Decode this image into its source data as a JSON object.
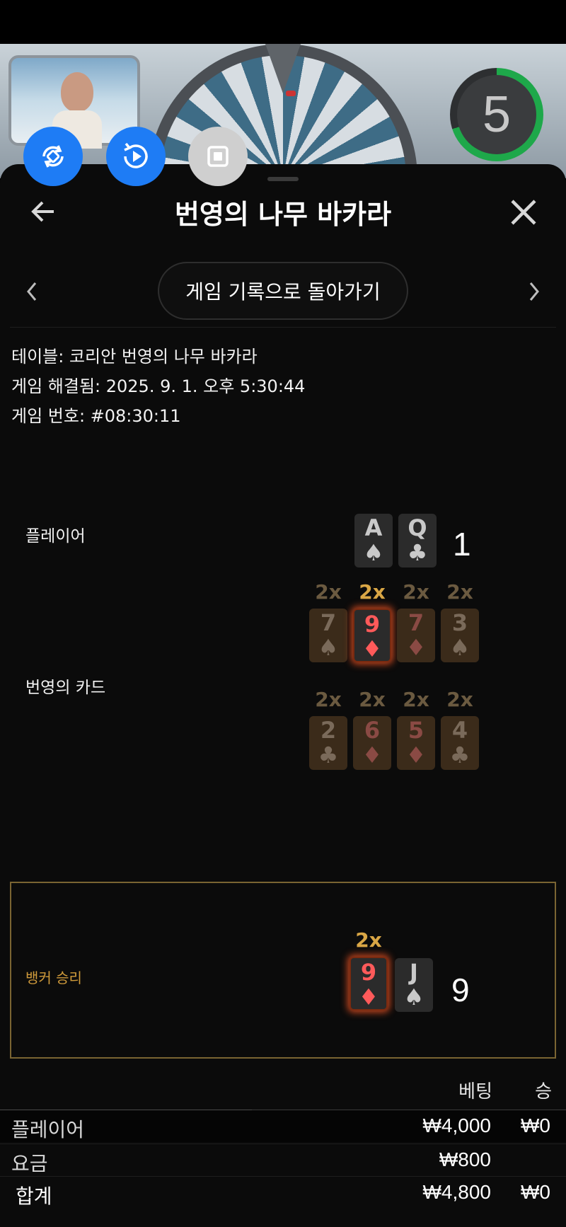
{
  "timer": {
    "value": "5",
    "progress": 0.7
  },
  "sheet": {
    "title": "번영의 나무 바카라",
    "history_button": "게임 기록으로 돌아가기"
  },
  "meta": {
    "table": "테이블: 코리안 번영의 나무 바카라",
    "resolved": "게임 해결됨: 2025. 9. 1. 오후 5:30:44",
    "number": "게임 번호: #08:30:11"
  },
  "player": {
    "label": "플레이어",
    "cards": [
      {
        "rank": "A",
        "suit": "♠"
      },
      {
        "rank": "Q",
        "suit": "♣"
      }
    ],
    "score": "1"
  },
  "fortune": {
    "label": "번영의 카드",
    "row1": [
      {
        "mult": "2x",
        "rank": "7",
        "suit": "♠",
        "color": "black",
        "active": false
      },
      {
        "mult": "2x",
        "rank": "9",
        "suit": "♦",
        "color": "red",
        "active": true
      },
      {
        "mult": "2x",
        "rank": "7",
        "suit": "♦",
        "color": "red",
        "active": false
      },
      {
        "mult": "2x",
        "rank": "3",
        "suit": "♠",
        "color": "black",
        "active": false
      }
    ],
    "row2": [
      {
        "mult": "2x",
        "rank": "2",
        "suit": "♣",
        "color": "black",
        "active": false
      },
      {
        "mult": "2x",
        "rank": "6",
        "suit": "♦",
        "color": "red",
        "active": false
      },
      {
        "mult": "2x",
        "rank": "5",
        "suit": "♦",
        "color": "red",
        "active": false
      },
      {
        "mult": "2x",
        "rank": "4",
        "suit": "♣",
        "color": "black",
        "active": false
      }
    ]
  },
  "banker": {
    "label": "뱅커 승리",
    "mult": "2x",
    "cards": [
      {
        "rank": "9",
        "suit": "♦",
        "color": "red",
        "active": true
      },
      {
        "rank": "J",
        "suit": "♠",
        "color": "black",
        "active": false
      }
    ],
    "score": "9"
  },
  "table": {
    "col_bet": "베팅",
    "col_win": "승",
    "rows": [
      {
        "label": "플레이어",
        "bet": "₩4,000",
        "win": "₩0"
      },
      {
        "label": "요금",
        "bet": "₩800",
        "win": ""
      },
      {
        "label": "합계",
        "bet": "₩4,800",
        "win": "₩0"
      }
    ]
  },
  "colors": {
    "accent_blue": "#1e7cf5",
    "gold": "#d9a645",
    "timer_green": "#1ea84a",
    "red_suit": "#e25b55"
  }
}
